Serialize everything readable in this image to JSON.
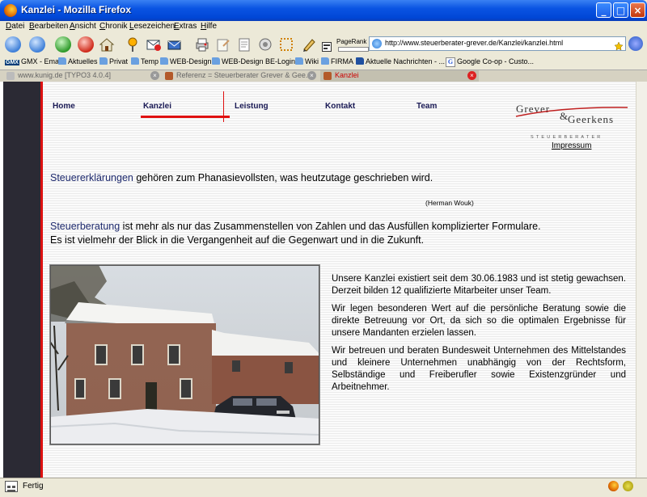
{
  "window": {
    "title": "Kanzlei - Mozilla Firefox"
  },
  "menubar": {
    "items": [
      "Datei",
      "Bearbeiten",
      "Ansicht",
      "Chronik",
      "Lesezeichen",
      "Extras",
      "Hilfe"
    ]
  },
  "toolbar": {
    "pagerank_label": "PageRank",
    "url": "http://www.steuerberater-grever.de/Kanzlei/kanzlei.html"
  },
  "bookmarks": [
    "GMX - Email",
    "Aktuelles",
    "Privat",
    "Temp",
    "WEB-Design",
    "WEB-Design BE-Logins",
    "Wiki",
    "FIRMA",
    "Aktuelle Nachrichten - ...",
    "Google Co-op - Custo..."
  ],
  "tabs": [
    {
      "label": "www.kunig.de [TYPO3 4.0.4]"
    },
    {
      "label": "Referenz = Steuerberater Grever & Gee..."
    },
    {
      "label": "Kanzlei"
    }
  ],
  "site": {
    "nav": [
      "Home",
      "Kanzlei",
      "Leistung",
      "Kontakt",
      "Team"
    ],
    "logo": {
      "name_1": "Grever",
      "amp": "&",
      "name_2": "Geerkens",
      "tagline": "STEUERBERATER"
    },
    "impressum": "Impressum",
    "quote": {
      "highlight": "Steuererklärungen",
      "rest": " gehören zum Phanasievollsten, was heutzutage geschrieben wird.",
      "author": "(Herman Wouk)"
    },
    "intro": {
      "highlight": "Steuerberatung",
      "line1_rest": " ist mehr als nur das Zusammenstellen von Zahlen und das Ausfüllen komplizierter Formulare.",
      "line2": "Es ist vielmehr der Blick in die Vergangenheit auf die Gegenwart und in die Zukunft."
    },
    "body": [
      "Unsere Kanzlei existiert seit dem 30.06.1983 und ist stetig gewachsen. Derzeit bilden 12 qualifizierte Mitarbeiter unser Team.",
      "Wir legen besonderen Wert auf die persönliche Beratung sowie die direkte Betreuung vor Ort, da sich so die optimalen Ergebnisse für unsere Mandanten erzielen lassen.",
      "Wir betreuen und beraten Bundesweit Unternehmen des Mittelstandes und kleinere Unternehmen unabhängig von der Rechtsform, Selbständige und Freiberufler sowie Existenzgründer und Arbeitnehmer."
    ]
  },
  "statusbar": {
    "text": "Fertig"
  },
  "colors": {
    "accent_red": "#e01010",
    "nav_text": "#1a1a55",
    "highlight_text": "#1e2a6e"
  }
}
